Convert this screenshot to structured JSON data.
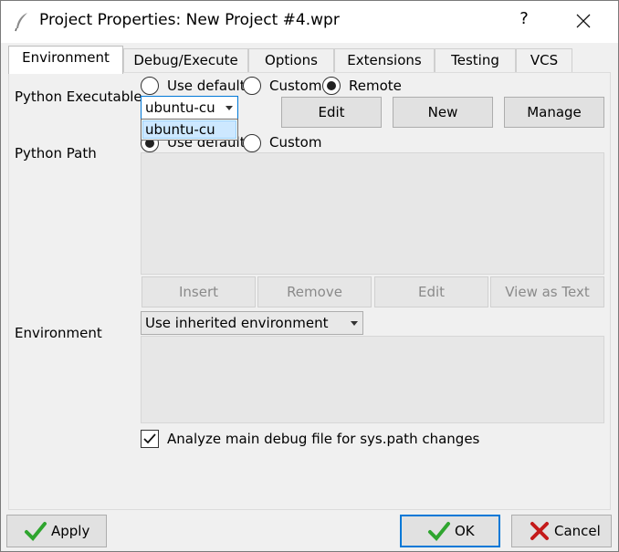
{
  "window": {
    "title": "Project Properties: New Project #4.wpr",
    "help": "?",
    "app_icon": "quill-icon",
    "close_icon": "close-icon"
  },
  "tabs": [
    {
      "label": "Environment",
      "active": true
    },
    {
      "label": "Debug/Execute",
      "active": false
    },
    {
      "label": "Options",
      "active": false
    },
    {
      "label": "Extensions",
      "active": false
    },
    {
      "label": "Testing",
      "active": false
    },
    {
      "label": "VCS",
      "active": false
    }
  ],
  "python_executable": {
    "label": "Python Executable",
    "options": [
      "Use default",
      "Custom",
      "Remote"
    ],
    "selected": "Remote",
    "host_value": "ubuntu-cu",
    "dropdown_items": [
      "ubuntu-cu"
    ],
    "buttons": [
      "Edit",
      "New",
      "Manage"
    ]
  },
  "python_path": {
    "label": "Python Path",
    "options": [
      "Use default",
      "Custom"
    ],
    "selected": "Use default",
    "buttons": [
      "Insert",
      "Remove",
      "Edit",
      "View as Text"
    ]
  },
  "environment": {
    "label": "Environment",
    "select_value": "Use inherited environment"
  },
  "analyze_checkbox": {
    "label": "Analyze main debug file for sys.path changes",
    "checked": true
  },
  "footer": {
    "apply": "Apply",
    "ok": "OK",
    "cancel": "Cancel"
  },
  "colors": {
    "accent": "#0078d7",
    "check_green": "#2fa52f",
    "cancel_red": "#c41a1a"
  }
}
